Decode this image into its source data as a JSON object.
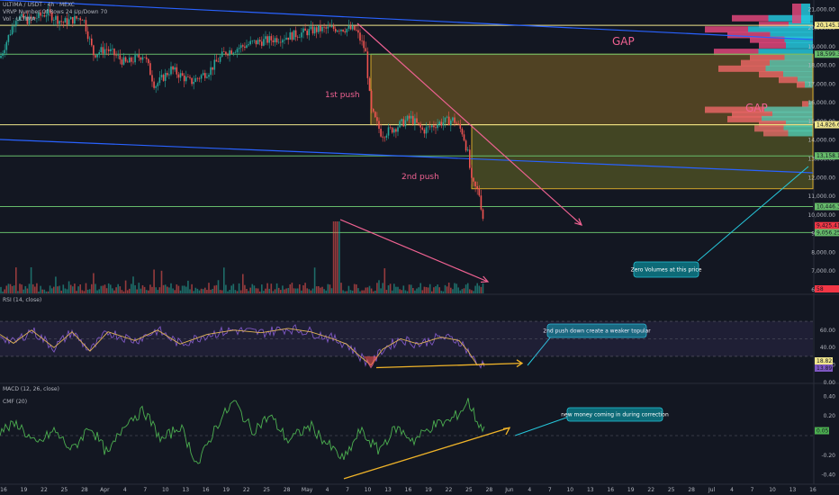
{
  "header": {
    "symbol_line": "ULTIMA / USDT · 4h · MEXC",
    "vrvp_line": "VRVP Number Of Rows 24 Up/Down 70",
    "vol_line": "Vol · ULTIMA"
  },
  "annotations": {
    "gap_top": "GAP",
    "gap_mid": "GAP",
    "push1": "1st push",
    "push2": "2nd push",
    "zero_volumes": "Zero Volumes at this price",
    "rsi_note": "2nd push down create a weaker topular",
    "cmf_note": "new money coming in during correction"
  },
  "price_axis": {
    "ticks": [
      "21,000.00",
      "20,000.00",
      "19,000.00",
      "18,000.00",
      "17,000.00",
      "16,000.00",
      "15,000.00",
      "14,000.00",
      "13,000.00",
      "12,000.00",
      "11,000.00",
      "10,000.00",
      "9,000.00",
      "8,000.00",
      "7,000.00",
      "6,000.00"
    ],
    "badges": [
      {
        "text": "20,145.14",
        "color": "#f0e68c"
      },
      {
        "text": "18,599.32",
        "color": "#66bb6a"
      },
      {
        "text": "14,826.68",
        "color": "#f0e68c"
      },
      {
        "text": "13,158.13",
        "color": "#66bb6a"
      },
      {
        "text": "10,446.39",
        "color": "#66bb6a"
      },
      {
        "text": "9,425.41",
        "color": "#f23645"
      },
      {
        "text": "9,056.25",
        "color": "#66bb6a"
      },
      {
        "text": "58",
        "color": "#f23645"
      }
    ]
  },
  "rsi": {
    "title": "RSI (14, close)",
    "ticks": [
      "60.00",
      "40.00",
      "20.00",
      "0.00"
    ],
    "badges": [
      {
        "text": "18.82",
        "color": "#f0e68c"
      },
      {
        "text": "13.89",
        "color": "#7e57c2"
      }
    ]
  },
  "macd_title": "MACD (12, 26, close)",
  "cmf": {
    "title": "CMF (20)",
    "ticks": [
      "0.40",
      "0.20",
      "-0.20",
      "-0.40"
    ],
    "badge": {
      "text": "0.05",
      "color": "#4caf50"
    }
  },
  "time_axis": [
    "16",
    "19",
    "22",
    "25",
    "28",
    "Apr",
    "4",
    "7",
    "10",
    "13",
    "16",
    "19",
    "22",
    "25",
    "28",
    "May",
    "4",
    "7",
    "10",
    "13",
    "16",
    "19",
    "22",
    "25",
    "28",
    "Jun",
    "4",
    "7",
    "10",
    "13",
    "16",
    "19",
    "22",
    "25",
    "28",
    "Jul",
    "4",
    "7",
    "10",
    "13",
    "16"
  ],
  "colors": {
    "background": "#131722",
    "up": "#26a69a",
    "down": "#ef5350",
    "yellow_line": "#f0e68c",
    "green_line": "#66bb6a",
    "trendline": "#2962ff",
    "arrow": "#f06292",
    "rsi_line": "#7e57c2",
    "cmf_line": "#4caf50",
    "note_box": "#0d6a77"
  },
  "chart_data": {
    "type": "candlestick",
    "series": [
      {
        "name": "ULTIMA / USDT",
        "x": [
          "Mar 16",
          "Mar 22",
          "Mar 28",
          "Apr 4",
          "Apr 10",
          "Apr 16",
          "Apr 22",
          "Apr 28",
          "May 4",
          "May 8",
          "May 10",
          "May 14",
          "May 20",
          "May 24",
          "May 26",
          "May 27"
        ],
        "values": [
          18400,
          20700,
          17600,
          16900,
          18100,
          18800,
          19200,
          19500,
          19800,
          19400,
          15300,
          14300,
          14800,
          14600,
          11700,
          9425
        ]
      }
    ],
    "horizontal_levels": [
      20145.14,
      18599.32,
      14826.68,
      13158.13,
      10446.39,
      9056.25
    ],
    "ylim": [
      5800,
      21500
    ],
    "rsi_levels": [
      70,
      50,
      30
    ],
    "cmf_range": [
      -0.45,
      0.45
    ]
  }
}
